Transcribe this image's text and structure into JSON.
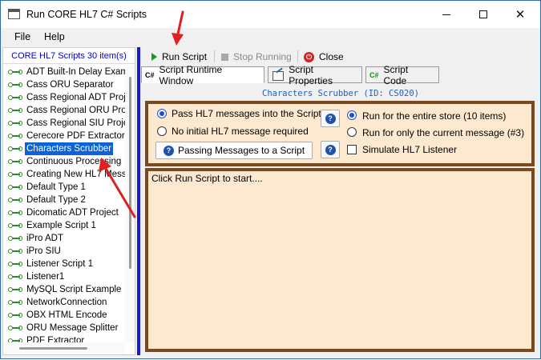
{
  "window": {
    "title": "Run CORE HL7 C# Scripts",
    "controls": {
      "minimize": "minimize",
      "maximize": "maximize",
      "close": "✕"
    }
  },
  "menu": {
    "file": "File",
    "help": "Help"
  },
  "sidebar": {
    "header": "CORE HL7 Scripts 30 item(s)",
    "items": [
      {
        "label": "ADT Built-In Delay Exam"
      },
      {
        "label": "Cass ORU Separator"
      },
      {
        "label": "Cass Regional ADT Proje"
      },
      {
        "label": "Cass Regional ORU Proj"
      },
      {
        "label": "Cass Regional SIU Proje"
      },
      {
        "label": "Cerecore PDF Extractor"
      },
      {
        "label": "Characters Scrubber",
        "selected": true
      },
      {
        "label": "Continuous Processing"
      },
      {
        "label": "Creating New HL7 Mess"
      },
      {
        "label": "Default Type 1"
      },
      {
        "label": "Default Type 2"
      },
      {
        "label": "Dicomatic ADT Project"
      },
      {
        "label": "Example Script 1"
      },
      {
        "label": "iPro ADT"
      },
      {
        "label": "iPro SIU"
      },
      {
        "label": "Listener Script 1"
      },
      {
        "label": "Listener1"
      },
      {
        "label": "MySQL Script Example"
      },
      {
        "label": "NetworkConnection"
      },
      {
        "label": "OBX HTML Encode"
      },
      {
        "label": "ORU Message Splitter"
      },
      {
        "label": "PDF Extractor"
      }
    ]
  },
  "toolbar": {
    "run": "Run Script",
    "stop": "Stop Running",
    "close": "Close"
  },
  "tabs": [
    {
      "label": "Script Runtime Window",
      "icon": "C#"
    },
    {
      "label": "Script Properties",
      "icon": "properties-icon"
    },
    {
      "label": "Script Code",
      "icon": "C#"
    }
  ],
  "script_id_label": "Characters Scrubber (ID: CS020)",
  "options": {
    "pass_messages": "Pass HL7 messages into the Script",
    "no_initial": "No initial HL7 message required",
    "passing_button": "Passing Messages to a Script",
    "run_entire": "Run for the entire store (10 items)",
    "run_current": "Run for only the current message (#3)",
    "simulate": "Simulate HL7 Listener",
    "selected_input": "pass_messages",
    "selected_scope": "run_entire",
    "simulate_checked": false
  },
  "output": {
    "text": "Click Run Script to start...."
  },
  "colors": {
    "accent_blue": "#1a1acc",
    "panel_fill": "#fde9cf",
    "panel_border": "#7a4a1e",
    "annotation_arrow": "#e02020",
    "selection": "#0a64d8"
  }
}
